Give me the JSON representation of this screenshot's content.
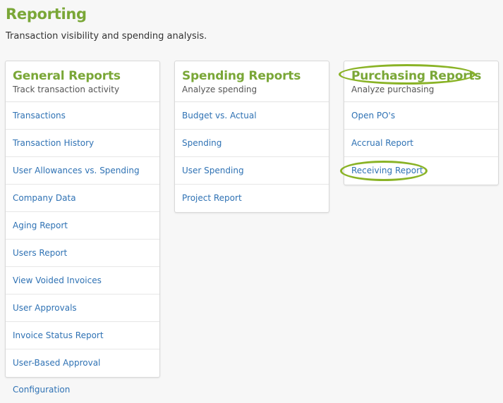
{
  "page": {
    "title": "Reporting",
    "subtitle": "Transaction visibility and spending analysis."
  },
  "cards": [
    {
      "title": "General Reports",
      "subtitle": "Track transaction activity",
      "items": [
        "Transactions",
        "Transaction History",
        "User Allowances vs. Spending",
        "Company Data",
        "Aging Report",
        "Users Report",
        "View Voided Invoices",
        "User Approvals",
        "Invoice Status Report",
        "User-Based Approval Configuration"
      ]
    },
    {
      "title": "Spending Reports",
      "subtitle": "Analyze spending",
      "items": [
        "Budget vs. Actual",
        "Spending",
        "User Spending",
        "Project Report"
      ]
    },
    {
      "title": "Purchasing Reports",
      "subtitle": "Analyze purchasing",
      "items": [
        "Open PO's",
        "Accrual Report",
        "Receiving Report"
      ]
    }
  ],
  "colors": {
    "accent": "#7aa737",
    "link": "#2f72b4",
    "highlight": "#8ab326"
  }
}
